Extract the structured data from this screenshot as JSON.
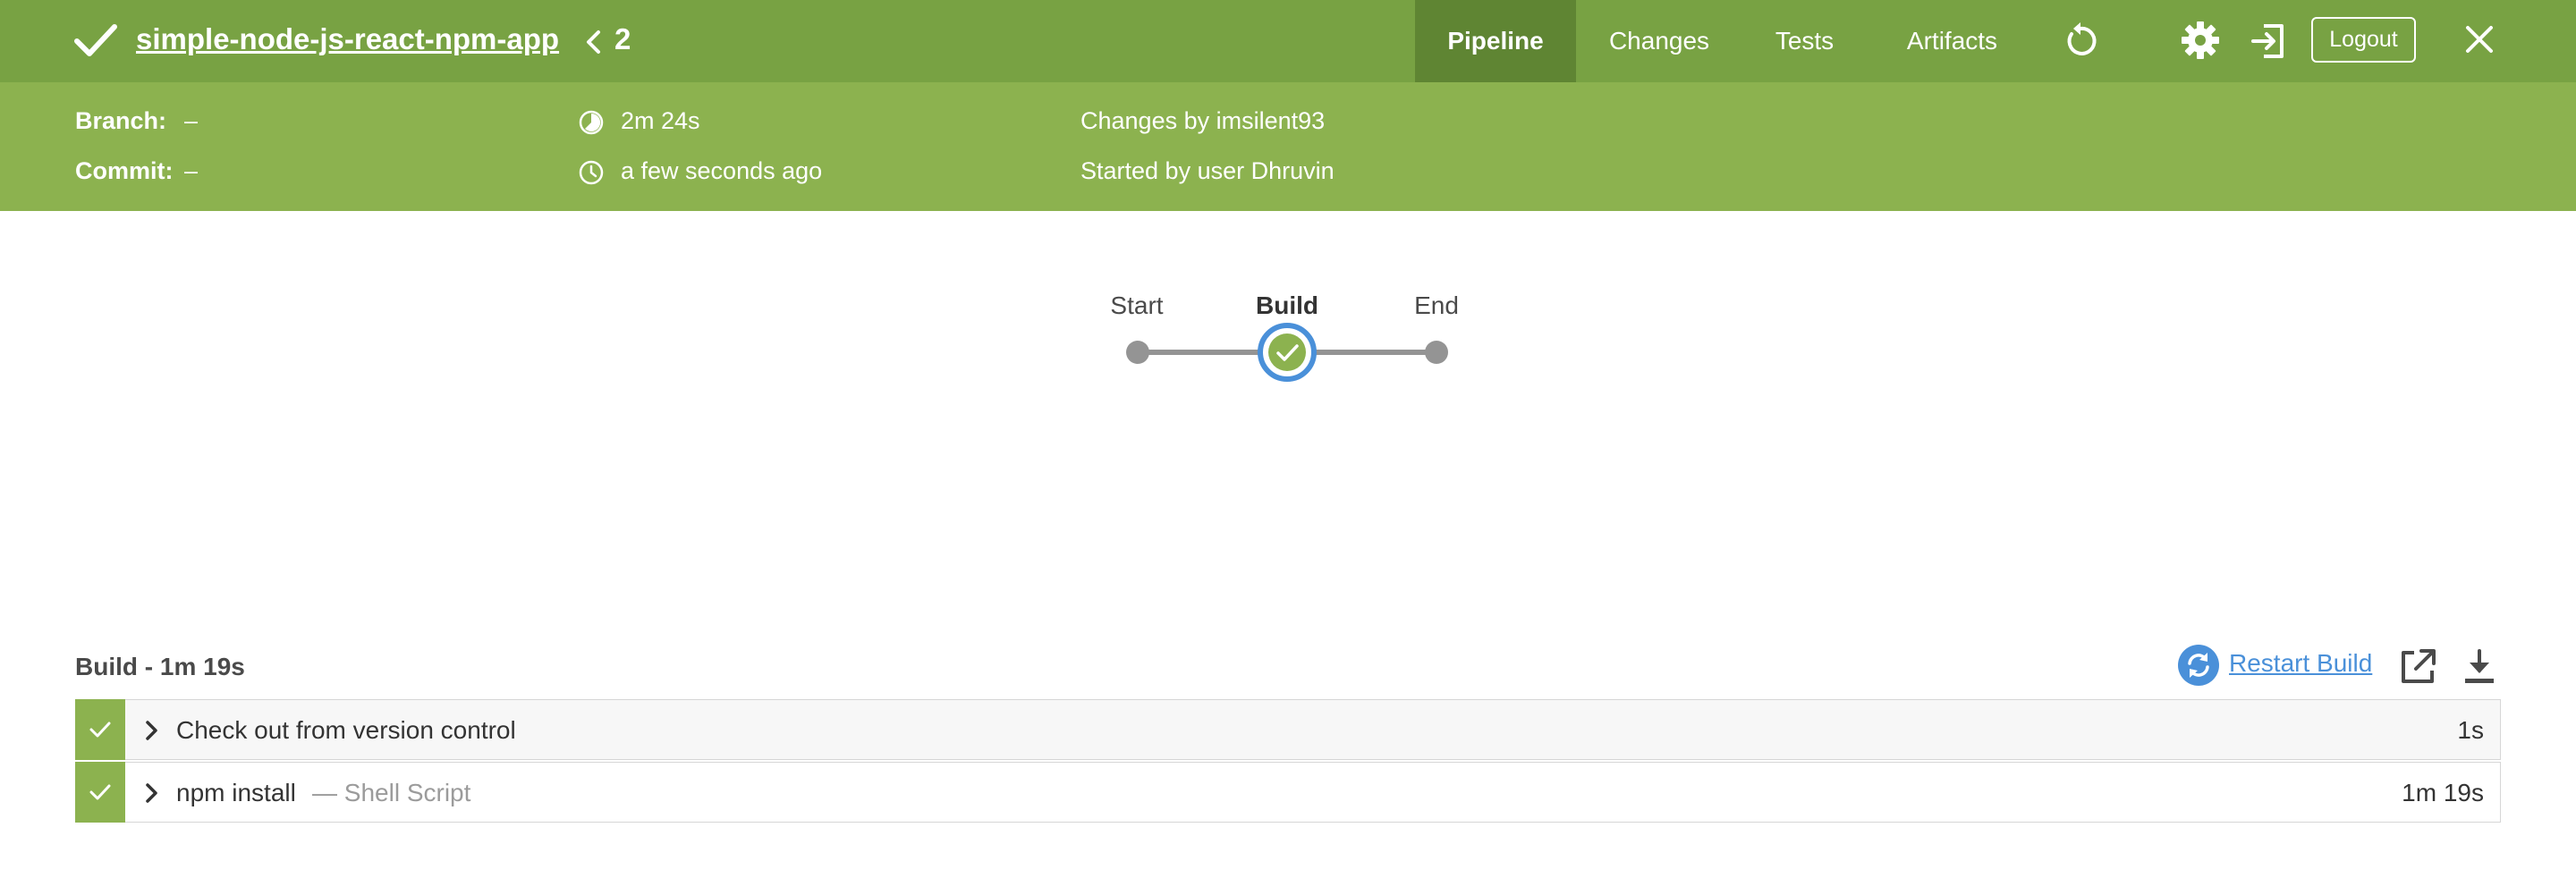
{
  "header": {
    "pipeline_name": "simple-node-js-react-npm-app",
    "run_number": "2",
    "status": "success",
    "tabs": [
      {
        "label": "Pipeline",
        "active": true
      },
      {
        "label": "Changes",
        "active": false
      },
      {
        "label": "Tests",
        "active": false
      },
      {
        "label": "Artifacts",
        "active": false
      }
    ],
    "icons": [
      "replay-icon",
      "gear-icon",
      "sign-out-icon",
      "close-icon"
    ],
    "logout_label": "Logout"
  },
  "info": {
    "branch_label": "Branch:",
    "branch_value": "–",
    "commit_label": "Commit:",
    "commit_value": "–",
    "duration": "2m 24s",
    "started": "a few seconds ago",
    "changes_by": "Changes by imsilent93",
    "started_by": "Started by user Dhruvin"
  },
  "graph": {
    "stages": [
      {
        "label": "Start",
        "type": "terminal"
      },
      {
        "label": "Build",
        "type": "stage",
        "status": "success",
        "selected": true
      },
      {
        "label": "End",
        "type": "terminal"
      }
    ]
  },
  "detail": {
    "title": "Build - 1m 19s",
    "restart_label": "Restart Build",
    "steps": [
      {
        "name": "Check out from version control",
        "sub": "",
        "duration": "1s",
        "status": "success"
      },
      {
        "name": "npm install",
        "sub": "— Shell Script",
        "duration": "1m 19s",
        "status": "success"
      }
    ]
  },
  "colors": {
    "header_bg": "#78a243",
    "info_bg": "#8cb24f",
    "active_tab_bg": "#5f8533",
    "success": "#8cb24f",
    "selection_ring": "#4a90d9",
    "link": "#4a90d9",
    "graph_node": "#949494"
  }
}
